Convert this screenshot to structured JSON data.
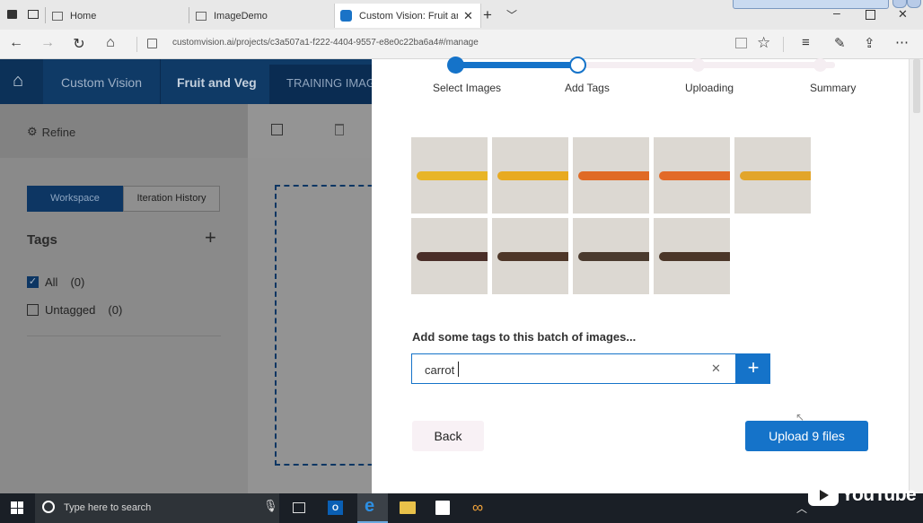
{
  "browser": {
    "tabs": [
      {
        "label": "Home"
      },
      {
        "label": "ImageDemo"
      },
      {
        "label": "Custom Vision: Fruit and"
      }
    ],
    "url": "customvision.ai/projects/c3a507a1-f222-4404-9557-e8e0c22ba6a4#/manage"
  },
  "app": {
    "header": {
      "brand": "Custom Vision",
      "project": "Fruit and Veg",
      "tab": "TRAINING IMAGES"
    },
    "refine_label": "Refine",
    "toggle": {
      "workspace": "Workspace",
      "history": "Iteration History"
    },
    "tags_heading": "Tags",
    "tag_items": [
      {
        "label": "All",
        "count": "(0)",
        "checked": true
      },
      {
        "label": "Untagged",
        "count": "(0)",
        "checked": false
      }
    ]
  },
  "modal": {
    "steps": [
      {
        "label": "Select Images"
      },
      {
        "label": "Add Tags"
      },
      {
        "label": "Uploading"
      },
      {
        "label": "Summary"
      }
    ],
    "image_count": 9,
    "carrot_colors": [
      "#e8b528",
      "#e8aa20",
      "#e06a25",
      "#e26a28",
      "#e2a52a",
      "#4a2e28",
      "#4e3628",
      "#4a3a2e",
      "#4b3628"
    ],
    "tag_prompt": "Add some tags to this batch of images...",
    "tag_value": "carrot",
    "back_label": "Back",
    "upload_label": "Upload 9 files",
    "accent": "#1573c9"
  },
  "taskbar": {
    "search_placeholder": "Type here to search"
  },
  "overlay": {
    "youtube": "YouTube"
  }
}
